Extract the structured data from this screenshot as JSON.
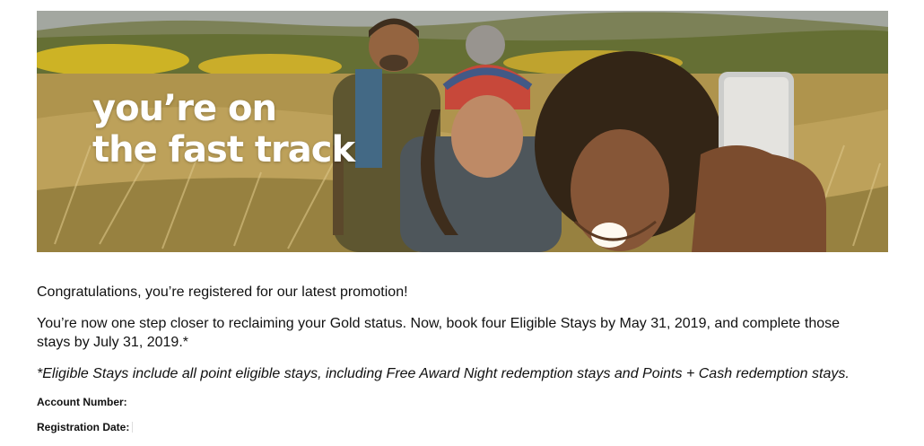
{
  "hero": {
    "headline_line1": "you’re on",
    "headline_line2": "the fast track",
    "image_description_icon": "hikers-selfie-photo"
  },
  "content": {
    "congrats": "Congratulations, you’re registered for our latest promotion!",
    "details": "You’re now one step closer to reclaiming your Gold status. Now, book four Eligible Stays by May 31, 2019, and complete those stays by July 31, 2019.*",
    "footnote": "*Eligible Stays include all point eligible stays, including Free Award Night redemption stays and Points + Cash redemption stays."
  },
  "account": {
    "account_number_label": "Account Number:",
    "account_number_value": "",
    "registration_date_label": "Registration Date:",
    "registration_date_value": ""
  },
  "colors": {
    "text": "#111111",
    "headline": "#ffffff"
  }
}
